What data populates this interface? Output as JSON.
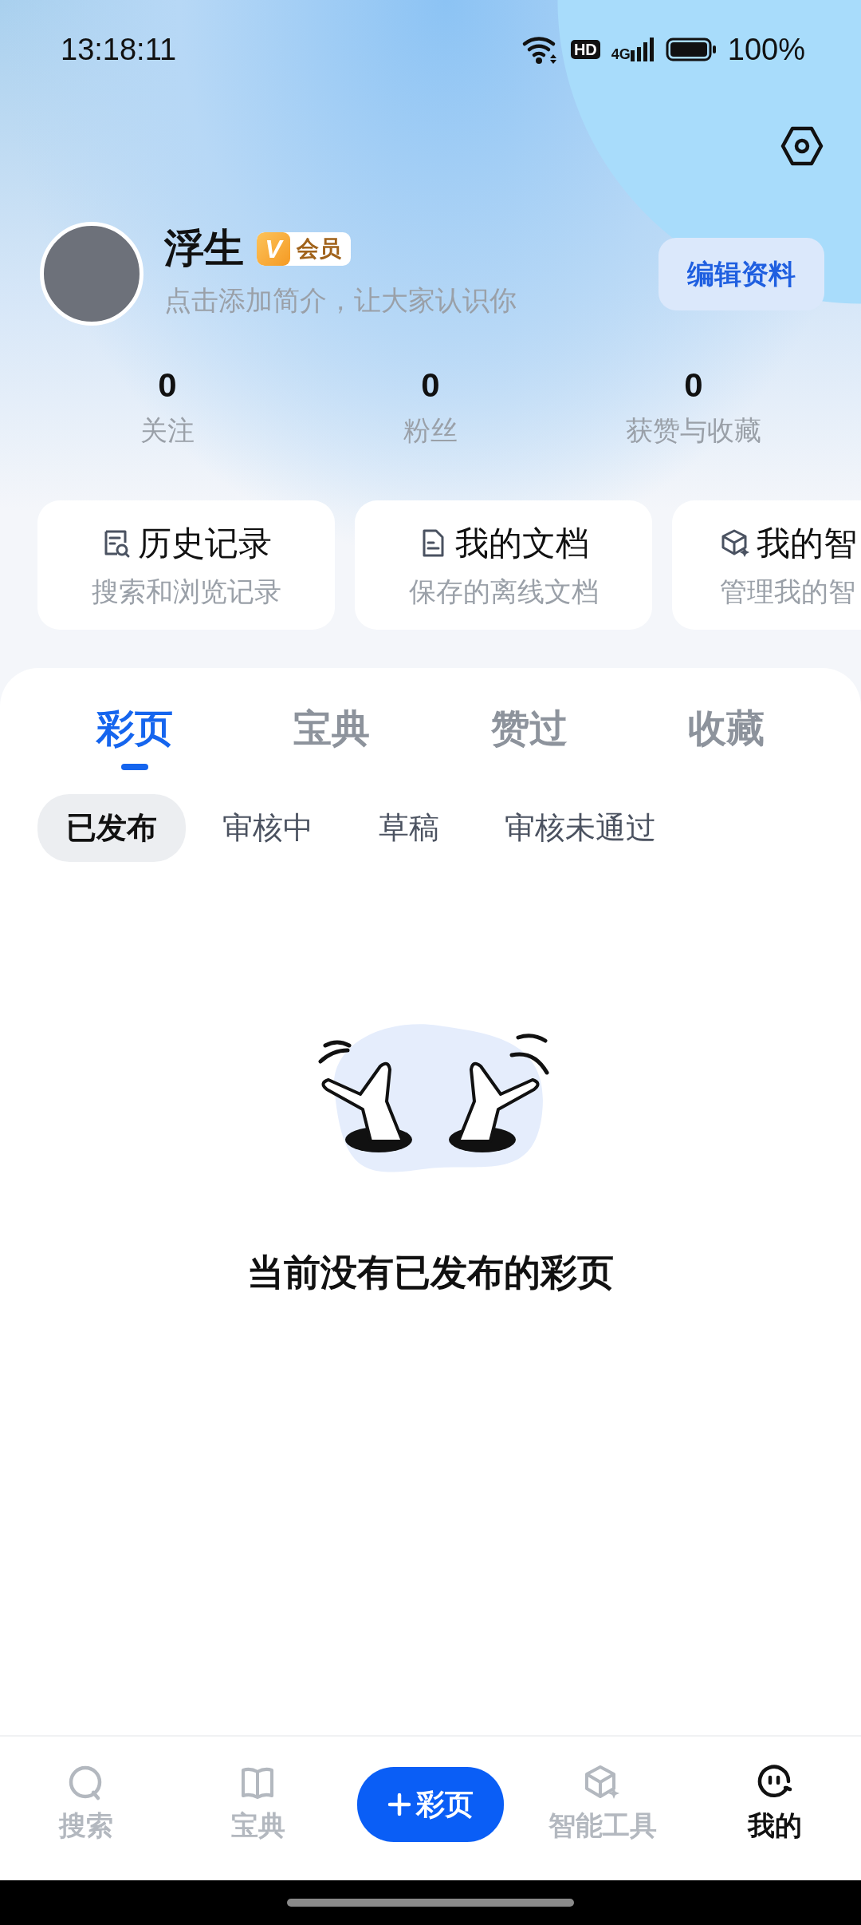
{
  "status_bar": {
    "time": "13:18:11",
    "hd": "HD",
    "network": "4G",
    "battery": "100%"
  },
  "profile": {
    "name": "浮生",
    "vip_letter": "V",
    "vip_badge": "会员",
    "bio": "点击添加简介，让大家认识你",
    "edit_button": "编辑资料"
  },
  "stats": [
    {
      "value": "0",
      "label": "关注"
    },
    {
      "value": "0",
      "label": "粉丝"
    },
    {
      "value": "0",
      "label": "获赞与收藏"
    }
  ],
  "shortcuts": [
    {
      "kind": "history",
      "title": "历史记录",
      "subtitle": "搜索和浏览记录"
    },
    {
      "kind": "document",
      "title": "我的文档",
      "subtitle": "保存的离线文档"
    },
    {
      "kind": "cube",
      "title": "我的智",
      "subtitle": "管理我的智"
    }
  ],
  "tabs": [
    {
      "label": "彩页",
      "selected": true
    },
    {
      "label": "宝典",
      "selected": false
    },
    {
      "label": "赞过",
      "selected": false
    },
    {
      "label": "收藏",
      "selected": false
    }
  ],
  "sub_tabs": [
    {
      "label": "已发布",
      "selected": true
    },
    {
      "label": "审核中",
      "selected": false
    },
    {
      "label": "草稿",
      "selected": false
    },
    {
      "label": "审核未通过",
      "selected": false
    }
  ],
  "empty_state": {
    "message": "当前没有已发布的彩页"
  },
  "bottom_nav": [
    {
      "kind": "search",
      "label": "搜索",
      "selected": false
    },
    {
      "kind": "book",
      "label": "宝典",
      "selected": false
    },
    {
      "kind": "create",
      "label": "彩页",
      "selected": false
    },
    {
      "kind": "tools",
      "label": "智能工具",
      "selected": false
    },
    {
      "kind": "me",
      "label": "我的",
      "selected": true
    }
  ]
}
